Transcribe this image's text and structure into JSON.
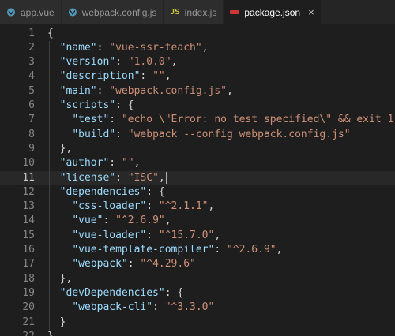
{
  "tabs": [
    {
      "label": "app.vue",
      "icon": "vue-icon",
      "active": false
    },
    {
      "label": "webpack.config.js",
      "icon": "vue-icon",
      "active": false
    },
    {
      "label": "index.js",
      "icon": "js-icon",
      "icon_text": "JS",
      "active": false
    },
    {
      "label": "package.json",
      "icon": "npm-icon",
      "active": true
    }
  ],
  "tab_close_glyph": "×",
  "colors": {
    "key": "#9cdcfe",
    "string": "#ce9178",
    "punct": "#d4d4d4",
    "line_number": "#858585",
    "background": "#1e1e1e"
  },
  "editor": {
    "current_line": 11,
    "lines": [
      {
        "n": "1",
        "tokens": [
          [
            "p",
            "{"
          ]
        ]
      },
      {
        "n": "2",
        "tokens": [
          [
            "p",
            "  "
          ],
          [
            "k",
            "\"name\""
          ],
          [
            "p",
            ": "
          ],
          [
            "s",
            "\"vue-ssr-teach\""
          ],
          [
            "p",
            ","
          ]
        ]
      },
      {
        "n": "3",
        "tokens": [
          [
            "p",
            "  "
          ],
          [
            "k",
            "\"version\""
          ],
          [
            "p",
            ": "
          ],
          [
            "s",
            "\"1.0.0\""
          ],
          [
            "p",
            ","
          ]
        ]
      },
      {
        "n": "4",
        "tokens": [
          [
            "p",
            "  "
          ],
          [
            "k",
            "\"description\""
          ],
          [
            "p",
            ": "
          ],
          [
            "s",
            "\"\""
          ],
          [
            "p",
            ","
          ]
        ]
      },
      {
        "n": "5",
        "tokens": [
          [
            "p",
            "  "
          ],
          [
            "k",
            "\"main\""
          ],
          [
            "p",
            ": "
          ],
          [
            "s",
            "\"webpack.config.js\""
          ],
          [
            "p",
            ","
          ]
        ]
      },
      {
        "n": "6",
        "tokens": [
          [
            "p",
            "  "
          ],
          [
            "k",
            "\"scripts\""
          ],
          [
            "p",
            ": {"
          ]
        ]
      },
      {
        "n": "7",
        "tokens": [
          [
            "p",
            "    "
          ],
          [
            "k",
            "\"test\""
          ],
          [
            "p",
            ": "
          ],
          [
            "s",
            "\"echo \\\"Error: no test specified\\\" && exit 1\""
          ],
          [
            "p",
            ","
          ]
        ]
      },
      {
        "n": "8",
        "tokens": [
          [
            "p",
            "    "
          ],
          [
            "k",
            "\"build\""
          ],
          [
            "p",
            ": "
          ],
          [
            "s",
            "\"webpack --config webpack.config.js\""
          ]
        ]
      },
      {
        "n": "9",
        "tokens": [
          [
            "p",
            "  },"
          ]
        ]
      },
      {
        "n": "10",
        "tokens": [
          [
            "p",
            "  "
          ],
          [
            "k",
            "\"author\""
          ],
          [
            "p",
            ": "
          ],
          [
            "s",
            "\"\""
          ],
          [
            "p",
            ","
          ]
        ]
      },
      {
        "n": "11",
        "tokens": [
          [
            "p",
            "  "
          ],
          [
            "k",
            "\"license\""
          ],
          [
            "p",
            ": "
          ],
          [
            "s",
            "\"ISC\""
          ],
          [
            "p",
            ","
          ]
        ]
      },
      {
        "n": "12",
        "tokens": [
          [
            "p",
            "  "
          ],
          [
            "k",
            "\"dependencies\""
          ],
          [
            "p",
            ": {"
          ]
        ]
      },
      {
        "n": "13",
        "tokens": [
          [
            "p",
            "    "
          ],
          [
            "k",
            "\"css-loader\""
          ],
          [
            "p",
            ": "
          ],
          [
            "s",
            "\"^2.1.1\""
          ],
          [
            "p",
            ","
          ]
        ]
      },
      {
        "n": "14",
        "tokens": [
          [
            "p",
            "    "
          ],
          [
            "k",
            "\"vue\""
          ],
          [
            "p",
            ": "
          ],
          [
            "s",
            "\"^2.6.9\""
          ],
          [
            "p",
            ","
          ]
        ]
      },
      {
        "n": "15",
        "tokens": [
          [
            "p",
            "    "
          ],
          [
            "k",
            "\"vue-loader\""
          ],
          [
            "p",
            ": "
          ],
          [
            "s",
            "\"^15.7.0\""
          ],
          [
            "p",
            ","
          ]
        ]
      },
      {
        "n": "16",
        "tokens": [
          [
            "p",
            "    "
          ],
          [
            "k",
            "\"vue-template-compiler\""
          ],
          [
            "p",
            ": "
          ],
          [
            "s",
            "\"^2.6.9\""
          ],
          [
            "p",
            ","
          ]
        ]
      },
      {
        "n": "17",
        "tokens": [
          [
            "p",
            "    "
          ],
          [
            "k",
            "\"webpack\""
          ],
          [
            "p",
            ": "
          ],
          [
            "s",
            "\"^4.29.6\""
          ]
        ]
      },
      {
        "n": "18",
        "tokens": [
          [
            "p",
            "  },"
          ]
        ]
      },
      {
        "n": "19",
        "tokens": [
          [
            "p",
            "  "
          ],
          [
            "k",
            "\"devDependencies\""
          ],
          [
            "p",
            ": {"
          ]
        ]
      },
      {
        "n": "20",
        "tokens": [
          [
            "p",
            "    "
          ],
          [
            "k",
            "\"webpack-cli\""
          ],
          [
            "p",
            ": "
          ],
          [
            "s",
            "\"^3.3.0\""
          ]
        ]
      },
      {
        "n": "21",
        "tokens": [
          [
            "p",
            "  }"
          ]
        ]
      },
      {
        "n": "22",
        "tokens": [
          [
            "p",
            "}"
          ]
        ]
      }
    ]
  }
}
